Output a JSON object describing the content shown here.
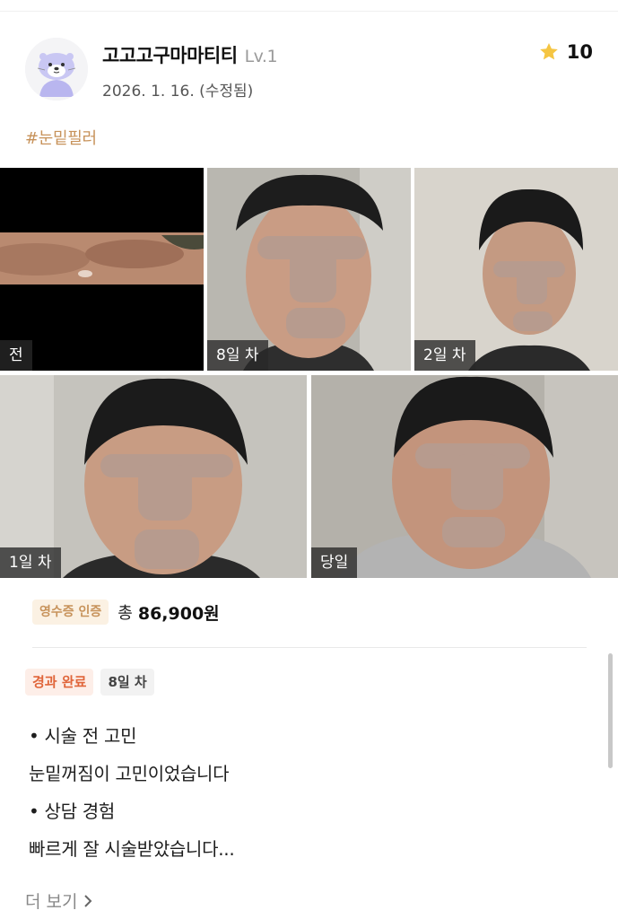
{
  "author": {
    "name": "고고고구마마티티",
    "level": "Lv.1",
    "date": "2026. 1. 16. (수정됨)",
    "avatar_icon": "otter-avatar-icon"
  },
  "rating": {
    "value": "10",
    "icon": "star-icon",
    "color": "#f5c542"
  },
  "hashtag": "#눈밑필러",
  "photos": [
    {
      "label": "전"
    },
    {
      "label": "8일 차"
    },
    {
      "label": "2일 차"
    },
    {
      "label": "1일 차"
    },
    {
      "label": "당일"
    }
  ],
  "receipt": {
    "badge": "영수증 인증",
    "total_label": "총",
    "amount": "86,900원"
  },
  "status": {
    "badge": "경과 완료",
    "day": "8일 차"
  },
  "review": {
    "lines": [
      "• 시술 전 고민",
      "눈밑꺼짐이 고민이었습니다",
      "• 상담 경험",
      "빠르게 잘 시술받았습니다..."
    ]
  },
  "more": {
    "label": "더 보기",
    "icon": "chevron-right-icon"
  },
  "colors": {
    "accent": "#c7925a",
    "status": "#e0653a"
  }
}
